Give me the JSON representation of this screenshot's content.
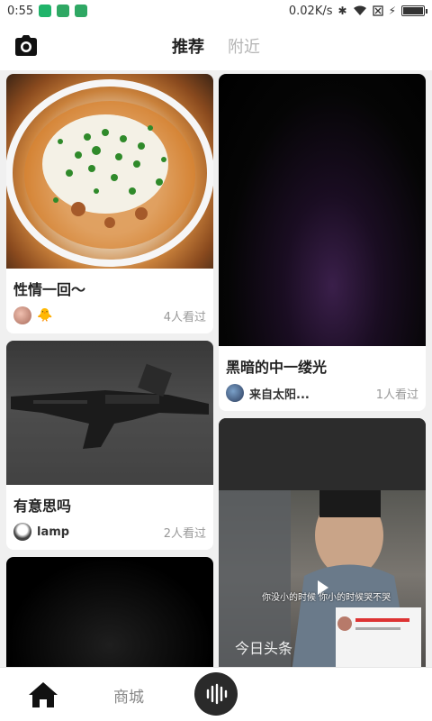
{
  "status": {
    "time": "0:55",
    "net_speed": "0.02K/s",
    "battery_level": 0.9
  },
  "header": {
    "tabs": [
      {
        "label": "推荐",
        "active": true
      },
      {
        "label": "附近",
        "active": false
      }
    ],
    "camera_icon": "camera-icon"
  },
  "feed": {
    "left": [
      {
        "title": "性情一回～",
        "author": "",
        "views": "4人看过",
        "image": "noodle-dish"
      },
      {
        "title": "有意思吗",
        "author": "lamp",
        "views": "2人看过",
        "image": "rifle"
      },
      {
        "title": "",
        "author": "",
        "views": "",
        "image": "dark-video"
      }
    ],
    "right": [
      {
        "title": "黑暗的中一缕光",
        "author": "来自太阳...",
        "views": "1人看过",
        "image": "dark-purple-glow"
      },
      {
        "title": "",
        "author": "",
        "views": "",
        "image": "video-still",
        "caption": "你没小的时候 你小的时候哭不哭",
        "watermark": "今日头条"
      }
    ]
  },
  "nav": {
    "home_icon": "home-icon",
    "mall_label": "商城",
    "record_icon": "soundwave-icon"
  },
  "colors": {
    "accent_dark": "#2a2a2a",
    "inactive_text": "#b4b4b4"
  }
}
